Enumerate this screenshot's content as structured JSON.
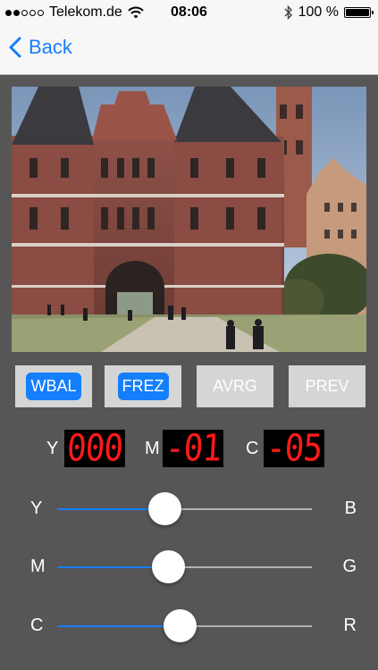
{
  "status_bar": {
    "signal_full": 2,
    "signal_empty": 3,
    "carrier": "Telekom.de",
    "time": "08:06",
    "battery_text": "100 %",
    "battery_level": 1.0,
    "icons": [
      "wifi-icon",
      "bluetooth-icon",
      "battery-icon"
    ]
  },
  "nav": {
    "back_label": "Back",
    "accent_color": "#157efb"
  },
  "buttons": [
    {
      "label": "WBAL",
      "active": true
    },
    {
      "label": "FREZ",
      "active": true
    },
    {
      "label": "AVRG",
      "active": false
    },
    {
      "label": "PREV",
      "active": false
    }
  ],
  "readouts": [
    {
      "letter": "Y",
      "value": "000"
    },
    {
      "letter": "M",
      "value": "-01"
    },
    {
      "letter": "C",
      "value": "-05"
    }
  ],
  "sliders": [
    {
      "left": "Y",
      "right": "B",
      "value": 0.42
    },
    {
      "left": "M",
      "right": "G",
      "value": 0.435
    },
    {
      "left": "C",
      "right": "R",
      "value": 0.48
    }
  ],
  "colors": {
    "background": "#565656",
    "lcd_digits": "#ff1a1a",
    "button_inactive": "#d5d5d5"
  }
}
